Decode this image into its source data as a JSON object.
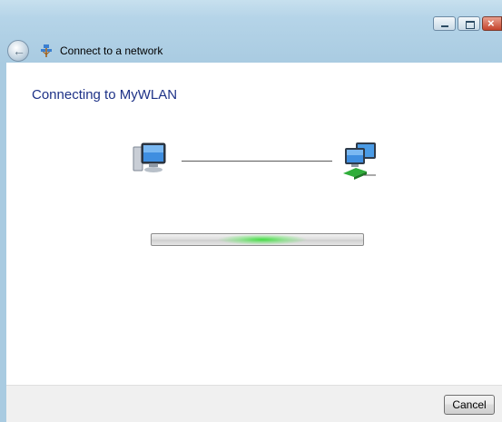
{
  "window": {
    "title": "Connect to a network",
    "controls": [
      "minimize",
      "maximize",
      "close"
    ]
  },
  "nav": {
    "back_icon": "back-arrow-icon",
    "network_icon": "network-icon"
  },
  "content": {
    "heading": "Connecting to MyWLAN",
    "source_icon": "computer-icon",
    "target_icon": "network-computers-icon",
    "progress": {
      "style": "marquee",
      "accent_color": "#33dd33"
    }
  },
  "footer": {
    "cancel_label": "Cancel"
  },
  "colors": {
    "heading": "#1e3287",
    "frame": "#a9cbe1",
    "footer_bg": "#f0f0f0"
  }
}
